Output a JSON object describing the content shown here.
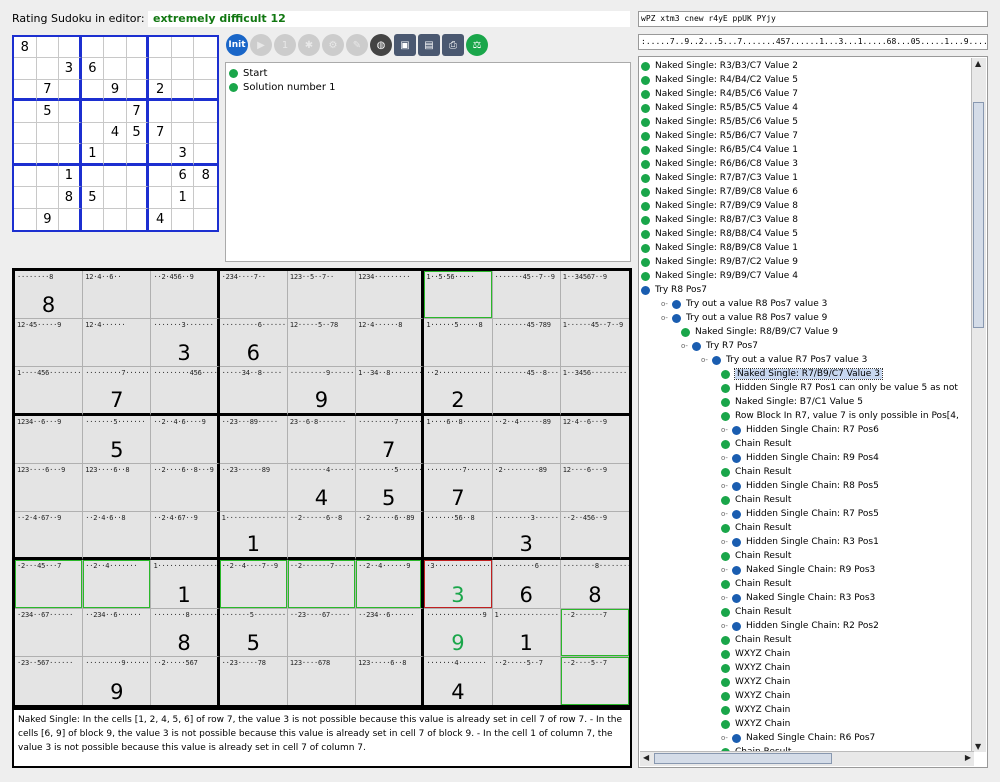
{
  "header": {
    "title_label": "Rating Sudoku in editor:",
    "puzzle_name": "extremely difficult 12",
    "code_top": "wPZ xtm3 cnew r4yE ppUK PYjy",
    "code_bottom": ":.....7..9..2...5...7.......457......1...3...1.....68...05.....1...9.......4..."
  },
  "toolbar": {
    "init_label": "Init",
    "buttons": [
      "init",
      "play-icon",
      "step-icon",
      "gear-icon",
      "settings-icon",
      "wrench-icon",
      "globe-icon",
      "save-icon",
      "export-icon",
      "print-icon",
      "balance-icon"
    ]
  },
  "steps": [
    {
      "label": "Start"
    },
    {
      "label": "Solution number 1"
    }
  ],
  "small_grid": [
    [
      "8",
      "",
      "",
      "",
      "",
      "",
      "",
      "",
      ""
    ],
    [
      "",
      "",
      "3",
      "6",
      "",
      "",
      "",
      "",
      ""
    ],
    [
      "",
      "7",
      "",
      "",
      "9",
      "",
      "2",
      "",
      ""
    ],
    [
      "",
      "5",
      "",
      "",
      "",
      "7",
      "",
      "",
      ""
    ],
    [
      "",
      "",
      "",
      "",
      "4",
      "5",
      "7",
      "",
      ""
    ],
    [
      "",
      "",
      "",
      "1",
      "",
      "",
      "",
      "3",
      ""
    ],
    [
      "",
      "",
      "1",
      "",
      "",
      "",
      "",
      "6",
      "8"
    ],
    [
      "",
      "",
      "8",
      "5",
      "",
      "",
      "",
      "1",
      ""
    ],
    [
      "",
      "9",
      "",
      "",
      "",
      "",
      "4",
      "",
      ""
    ]
  ],
  "main_grid": [
    [
      {
        "c": "········8",
        "v": "8"
      },
      {
        "c": "12·4··6··",
        "v": ""
      },
      {
        "c": "··2·456··9",
        "v": ""
      },
      {
        "c": "·234····7··",
        "v": ""
      },
      {
        "c": "123··5··7··",
        "v": ""
      },
      {
        "c": "1234·········",
        "v": ""
      },
      {
        "c": "1··5·56·····",
        "v": ""
      },
      {
        "c": "·······45··7··9",
        "v": ""
      },
      {
        "c": "1··34567··9",
        "v": ""
      }
    ],
    [
      {
        "c": "12·45·····9",
        "v": ""
      },
      {
        "c": "12·4······",
        "v": ""
      },
      {
        "c": "·······3·······",
        "v": "3"
      },
      {
        "c": "·········6·······",
        "v": "6"
      },
      {
        "c": "12·····5··78",
        "v": ""
      },
      {
        "c": "12·4······8",
        "v": ""
      },
      {
        "c": "1······5·····8",
        "v": ""
      },
      {
        "c": "········45·789",
        "v": ""
      },
      {
        "c": "1······45··7··9",
        "v": ""
      }
    ],
    [
      {
        "c": "1····456········",
        "v": ""
      },
      {
        "c": "·········7·······",
        "v": "7"
      },
      {
        "c": "·········456······",
        "v": ""
      },
      {
        "c": "·····34··8·····",
        "v": ""
      },
      {
        "c": "·········9·······",
        "v": "9"
      },
      {
        "c": "1··34··8········",
        "v": ""
      },
      {
        "c": "··2··············",
        "v": "2"
      },
      {
        "c": "········45··8····",
        "v": ""
      },
      {
        "c": "1··3456·········",
        "v": ""
      }
    ],
    [
      {
        "c": "1234··6···9",
        "v": ""
      },
      {
        "c": "·······5·······",
        "v": "5"
      },
      {
        "c": "··2··4·6····9",
        "v": ""
      },
      {
        "c": "··23···89·····",
        "v": ""
      },
      {
        "c": "23··6·8·······",
        "v": ""
      },
      {
        "c": "·········7······",
        "v": "7"
      },
      {
        "c": "1····6··8········",
        "v": ""
      },
      {
        "c": "··2··4······89",
        "v": ""
      },
      {
        "c": "12·4··6···9",
        "v": ""
      }
    ],
    [
      {
        "c": "123····6···9",
        "v": ""
      },
      {
        "c": "123····6··8",
        "v": ""
      },
      {
        "c": "··2····6··8···9",
        "v": ""
      },
      {
        "c": "··23······89",
        "v": ""
      },
      {
        "c": "·········4·······",
        "v": "4"
      },
      {
        "c": "·········5·······",
        "v": "5"
      },
      {
        "c": "·········7·······",
        "v": "7"
      },
      {
        "c": "·2·········89",
        "v": ""
      },
      {
        "c": "12····6···9",
        "v": ""
      }
    ],
    [
      {
        "c": "··2·4·67··9",
        "v": ""
      },
      {
        "c": "··2·4·6··8",
        "v": ""
      },
      {
        "c": "··2·4·67··9",
        "v": ""
      },
      {
        "c": "1················",
        "v": "1"
      },
      {
        "c": "··2······6··8",
        "v": ""
      },
      {
        "c": "··2······6··89",
        "v": ""
      },
      {
        "c": "·······56··8",
        "v": ""
      },
      {
        "c": "·········3·······",
        "v": "3"
      },
      {
        "c": "··2··456··9",
        "v": ""
      }
    ],
    [
      {
        "c": "·2···45···7",
        "v": ""
      },
      {
        "c": "··2··4·······",
        "v": ""
      },
      {
        "c": "1················",
        "v": "1"
      },
      {
        "c": "··2··4····7··9",
        "v": ""
      },
      {
        "c": "··2·······7·····",
        "v": ""
      },
      {
        "c": "··2··4······9",
        "v": ""
      },
      {
        "c": "·3···············",
        "v": "3"
      },
      {
        "c": "··········6······",
        "v": "6"
      },
      {
        "c": "········8········",
        "v": "8"
      }
    ],
    [
      {
        "c": "·234··67······",
        "v": ""
      },
      {
        "c": "··234··6······",
        "v": ""
      },
      {
        "c": "········8········",
        "v": "8"
      },
      {
        "c": "·······5·········",
        "v": "5"
      },
      {
        "c": "··23····67·····",
        "v": ""
      },
      {
        "c": "··234··6······",
        "v": ""
      },
      {
        "c": "··············9",
        "v": "9"
      },
      {
        "c": "1················",
        "v": "1"
      },
      {
        "c": "··2·······7",
        "v": ""
      }
    ],
    [
      {
        "c": "·23··567······",
        "v": ""
      },
      {
        "c": "·········9·······",
        "v": "9"
      },
      {
        "c": "··2·····567",
        "v": ""
      },
      {
        "c": "··23·····78",
        "v": ""
      },
      {
        "c": "123····678",
        "v": ""
      },
      {
        "c": "123·····6··8",
        "v": ""
      },
      {
        "c": "·······4·······",
        "v": "4"
      },
      {
        "c": "··2·····5··7",
        "v": ""
      },
      {
        "c": "··2····5··7",
        "v": ""
      }
    ]
  ],
  "hint_text": "Naked Single: In the cells [1, 2, 4, 5, 6] of row 7, the value 3 is not possible because this value is already set in cell 7 of row 7. - In the cells [6, 9] of block 9, the value 3 is not possible because this value is already set in cell 7 of block 9. - In the cell 1 of column 7, the value 3 is not possible because this value is already set in cell 7 of column 7.",
  "tree": [
    {
      "label": "Naked Single: R3/B3/C7 Value 2",
      "indent": 0,
      "dot": "g",
      "toggle": ""
    },
    {
      "label": "Naked Single: R4/B4/C2 Value 5",
      "indent": 0,
      "dot": "g",
      "toggle": ""
    },
    {
      "label": "Naked Single: R4/B5/C6 Value 7",
      "indent": 0,
      "dot": "g",
      "toggle": ""
    },
    {
      "label": "Naked Single: R5/B5/C5 Value 4",
      "indent": 0,
      "dot": "g",
      "toggle": ""
    },
    {
      "label": "Naked Single: R5/B5/C6 Value 5",
      "indent": 0,
      "dot": "g",
      "toggle": ""
    },
    {
      "label": "Naked Single: R5/B6/C7 Value 7",
      "indent": 0,
      "dot": "g",
      "toggle": ""
    },
    {
      "label": "Naked Single: R6/B5/C4 Value 1",
      "indent": 0,
      "dot": "g",
      "toggle": ""
    },
    {
      "label": "Naked Single: R6/B6/C8 Value 3",
      "indent": 0,
      "dot": "g",
      "toggle": ""
    },
    {
      "label": "Naked Single: R7/B7/C3 Value 1",
      "indent": 0,
      "dot": "g",
      "toggle": ""
    },
    {
      "label": "Naked Single: R7/B9/C8 Value 6",
      "indent": 0,
      "dot": "g",
      "toggle": ""
    },
    {
      "label": "Naked Single: R7/B9/C9 Value 8",
      "indent": 0,
      "dot": "g",
      "toggle": ""
    },
    {
      "label": "Naked Single: R8/B7/C3 Value 8",
      "indent": 0,
      "dot": "g",
      "toggle": ""
    },
    {
      "label": "Naked Single: R8/B8/C4 Value 5",
      "indent": 0,
      "dot": "g",
      "toggle": ""
    },
    {
      "label": "Naked Single: R8/B9/C8 Value 1",
      "indent": 0,
      "dot": "g",
      "toggle": ""
    },
    {
      "label": "Naked Single: R9/B7/C2 Value 9",
      "indent": 0,
      "dot": "g",
      "toggle": ""
    },
    {
      "label": "Naked Single: R9/B9/C7 Value 4",
      "indent": 0,
      "dot": "g",
      "toggle": ""
    },
    {
      "label": "Try R8 Pos7",
      "indent": 0,
      "dot": "b",
      "toggle": ""
    },
    {
      "label": "Try out a value R8 Pos7 value 3",
      "indent": 1,
      "dot": "b",
      "toggle": "o-"
    },
    {
      "label": "Try out a value R8 Pos7 value 9",
      "indent": 1,
      "dot": "b",
      "toggle": "o-"
    },
    {
      "label": "Naked Single: R8/B9/C7 Value 9",
      "indent": 2,
      "dot": "g",
      "toggle": ""
    },
    {
      "label": "Try R7 Pos7",
      "indent": 2,
      "dot": "b",
      "toggle": "o-"
    },
    {
      "label": "Try out a value R7 Pos7 value 3",
      "indent": 3,
      "dot": "b",
      "toggle": "o-"
    },
    {
      "label": "Naked Single: R7/B9/C7 Value 3",
      "indent": 4,
      "dot": "g",
      "toggle": "",
      "selected": true
    },
    {
      "label": "Hidden Single R7 Pos1 can only be value 5 as not",
      "indent": 4,
      "dot": "g",
      "toggle": ""
    },
    {
      "label": "Naked Single: B7/C1 Value 5",
      "indent": 4,
      "dot": "g",
      "toggle": ""
    },
    {
      "label": "Row Block In R7, value 7 is only possible in Pos[4,",
      "indent": 4,
      "dot": "g",
      "toggle": ""
    },
    {
      "label": "Hidden Single Chain: R7 Pos6",
      "indent": 4,
      "dot": "b",
      "toggle": "o-"
    },
    {
      "label": "Chain Result",
      "indent": 4,
      "dot": "g",
      "toggle": ""
    },
    {
      "label": "Hidden Single Chain: R9 Pos4",
      "indent": 4,
      "dot": "b",
      "toggle": "o-"
    },
    {
      "label": "Chain Result",
      "indent": 4,
      "dot": "g",
      "toggle": ""
    },
    {
      "label": "Hidden Single Chain: R8 Pos5",
      "indent": 4,
      "dot": "b",
      "toggle": "o-"
    },
    {
      "label": "Chain Result",
      "indent": 4,
      "dot": "g",
      "toggle": ""
    },
    {
      "label": "Hidden Single Chain: R7 Pos5",
      "indent": 4,
      "dot": "b",
      "toggle": "o-"
    },
    {
      "label": "Chain Result",
      "indent": 4,
      "dot": "g",
      "toggle": ""
    },
    {
      "label": "Hidden Single Chain: R3 Pos1",
      "indent": 4,
      "dot": "b",
      "toggle": "o-"
    },
    {
      "label": "Chain Result",
      "indent": 4,
      "dot": "g",
      "toggle": ""
    },
    {
      "label": "Naked Single Chain: R9 Pos3",
      "indent": 4,
      "dot": "b",
      "toggle": "o-"
    },
    {
      "label": "Chain Result",
      "indent": 4,
      "dot": "g",
      "toggle": ""
    },
    {
      "label": "Naked Single Chain: R3 Pos3",
      "indent": 4,
      "dot": "b",
      "toggle": "o-"
    },
    {
      "label": "Chain Result",
      "indent": 4,
      "dot": "g",
      "toggle": ""
    },
    {
      "label": "Hidden Single Chain: R2 Pos2",
      "indent": 4,
      "dot": "b",
      "toggle": "o-"
    },
    {
      "label": "Chain Result",
      "indent": 4,
      "dot": "g",
      "toggle": ""
    },
    {
      "label": "WXYZ Chain",
      "indent": 4,
      "dot": "g",
      "toggle": ""
    },
    {
      "label": "WXYZ Chain",
      "indent": 4,
      "dot": "g",
      "toggle": ""
    },
    {
      "label": "WXYZ Chain",
      "indent": 4,
      "dot": "g",
      "toggle": ""
    },
    {
      "label": "WXYZ Chain",
      "indent": 4,
      "dot": "g",
      "toggle": ""
    },
    {
      "label": "WXYZ Chain",
      "indent": 4,
      "dot": "g",
      "toggle": ""
    },
    {
      "label": "WXYZ Chain",
      "indent": 4,
      "dot": "g",
      "toggle": ""
    },
    {
      "label": "Naked Single Chain: R6 Pos7",
      "indent": 4,
      "dot": "b",
      "toggle": "o-"
    },
    {
      "label": "Chain Result",
      "indent": 4,
      "dot": "g",
      "toggle": ""
    }
  ],
  "colors": {
    "grid_blue": "#1c2fd0",
    "green": "#1aa64a",
    "red": "#c02020"
  }
}
